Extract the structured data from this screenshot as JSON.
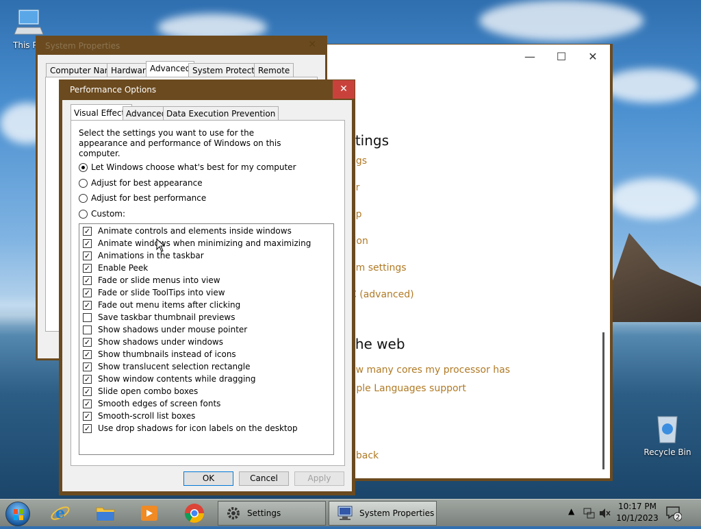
{
  "desktop": {
    "icons": [
      {
        "label": "This PC"
      },
      {
        "label": "Recycle Bin"
      }
    ]
  },
  "settings_window": {
    "controls": {
      "minimize": "—",
      "maximize": "☐",
      "close": "✕"
    },
    "heading_1": "ttings",
    "links_1": [
      "ngs",
      "er",
      "op",
      "tion",
      "em settings",
      "C (advanced)"
    ],
    "heading_2": " the web",
    "links_2": [
      "ow many cores my processor has",
      "tiple Languages support"
    ],
    "feedback": "dback"
  },
  "system_properties": {
    "title": "System Properties",
    "close": "✕",
    "tabs": [
      "Computer Name",
      "Hardware",
      "Advanced",
      "System Protection",
      "Remote"
    ],
    "active_tab": "Advanced"
  },
  "performance_options": {
    "title": "Performance Options",
    "close": "✕",
    "tabs": [
      "Visual Effects",
      "Advanced",
      "Data Execution Prevention"
    ],
    "active_tab": "Visual Effects",
    "description": "Select the settings you want to use for the appearance and performance of Windows on this computer.",
    "radios": [
      {
        "label": "Let Windows choose what's best for my computer",
        "checked": true
      },
      {
        "label": "Adjust for best appearance",
        "checked": false
      },
      {
        "label": "Adjust for best performance",
        "checked": false
      },
      {
        "label": "Custom:",
        "checked": false
      }
    ],
    "effects": [
      {
        "label": "Animate controls and elements inside windows",
        "checked": true
      },
      {
        "label": "Animate windows when minimizing and maximizing",
        "checked": true
      },
      {
        "label": "Animations in the taskbar",
        "checked": true
      },
      {
        "label": "Enable Peek",
        "checked": true
      },
      {
        "label": "Fade or slide menus into view",
        "checked": true
      },
      {
        "label": "Fade or slide ToolTips into view",
        "checked": true
      },
      {
        "label": "Fade out menu items after clicking",
        "checked": true
      },
      {
        "label": "Save taskbar thumbnail previews",
        "checked": false
      },
      {
        "label": "Show shadows under mouse pointer",
        "checked": false
      },
      {
        "label": "Show shadows under windows",
        "checked": true
      },
      {
        "label": "Show thumbnails instead of icons",
        "checked": true
      },
      {
        "label": "Show translucent selection rectangle",
        "checked": true
      },
      {
        "label": "Show window contents while dragging",
        "checked": true
      },
      {
        "label": "Slide open combo boxes",
        "checked": true
      },
      {
        "label": "Smooth edges of screen fonts",
        "checked": true
      },
      {
        "label": "Smooth-scroll list boxes",
        "checked": true
      },
      {
        "label": "Use drop shadows for icon labels on the desktop",
        "checked": true
      }
    ],
    "buttons": {
      "ok": "OK",
      "cancel": "Cancel",
      "apply": "Apply"
    }
  },
  "taskbar": {
    "task_buttons": [
      {
        "label": "Settings",
        "icon": "gear-icon"
      },
      {
        "label": "System Properties",
        "icon": "computer-icon"
      }
    ],
    "clock": {
      "time": "10:17 PM",
      "date": "10/1/2023"
    },
    "notification_count": "2",
    "colors": {
      "window_frame": "#6b4a1f",
      "close_red": "#c8423b",
      "link": "#b07a25"
    }
  }
}
